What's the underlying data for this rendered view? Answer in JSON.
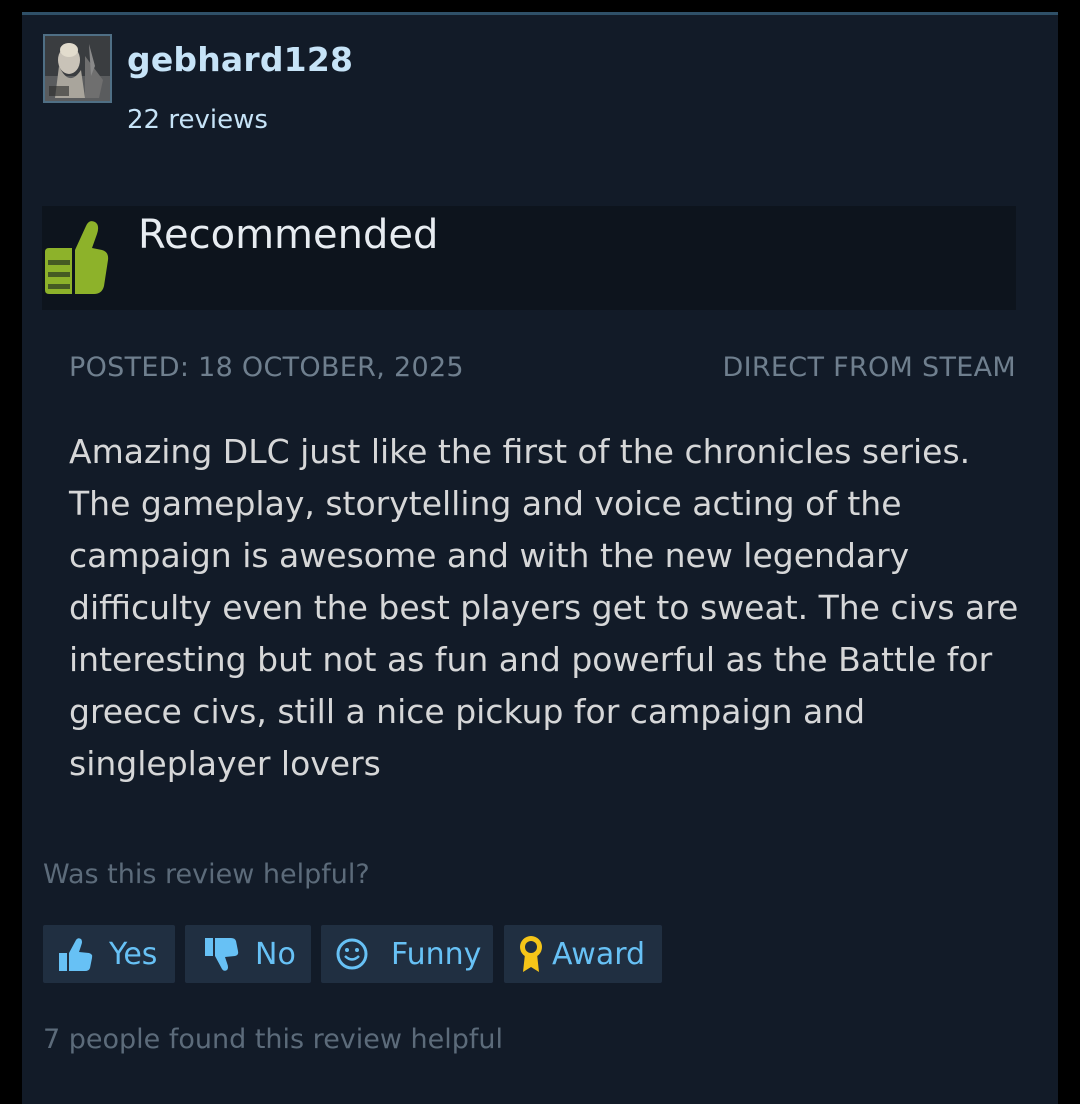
{
  "author": {
    "username": "gebhard128",
    "review_count": "22 reviews"
  },
  "verdict": {
    "label": "Recommended",
    "icon": "thumbs-up-icon",
    "icon_color": "#8db22a"
  },
  "meta": {
    "posted": "POSTED: 18 OCTOBER, 2025",
    "source": "DIRECT FROM STEAM"
  },
  "review": {
    "text": "Amazing DLC just like the first of the chronicles series. The gameplay, storytelling and voice acting of the campaign is awesome and with the new legendary difficulty even the best players get to sweat. The civs are interesting but not as fun and powerful as the Battle for greece civs, still a nice pickup for campaign and singleplayer lovers"
  },
  "feedback": {
    "question": "Was this review helpful?",
    "buttons": {
      "yes": "Yes",
      "no": "No",
      "funny": "Funny",
      "award": "Award"
    },
    "found_helpful": "7 people found this review helpful"
  },
  "colors": {
    "card_bg": "#121b28",
    "accent_blue": "#67c1f5",
    "award_gold": "#f5c518"
  }
}
